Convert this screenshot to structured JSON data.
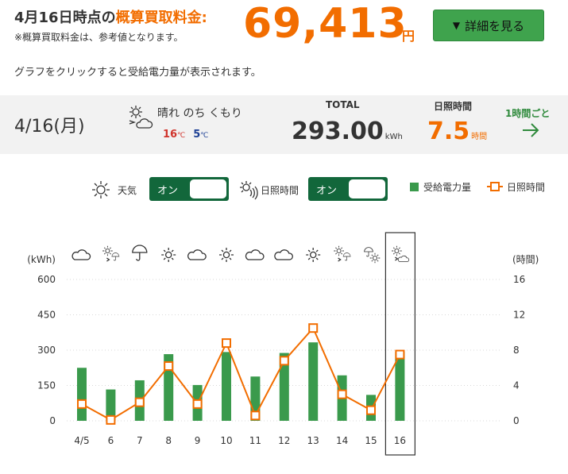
{
  "header": {
    "title_prefix": "4月16日時点の",
    "title_accent": "概算買取料金:",
    "amount": "69,413",
    "unit": "円",
    "note": "※概算買取料金は、参考値となります。",
    "detail_button": "詳細を見る",
    "hint": "グラフをクリックすると受給電力量が表示されます。"
  },
  "summary": {
    "date": "4/16(月)",
    "weather": "晴れ のち くもり",
    "temp_high": "16",
    "temp_low": "5",
    "temp_unit": "℃",
    "total_label": "TOTAL",
    "total_value": "293.00",
    "total_unit": "kWh",
    "sunshine_label": "日照時間",
    "sunshine_value": "7.5",
    "sunshine_unit": "時間",
    "hourly_link": "1時間ごと"
  },
  "controls": {
    "weather_label": "天気",
    "weather_toggle": "オン",
    "sunshine_label": "日照時間",
    "sunshine_toggle": "オン",
    "legend_power": "受給電力量",
    "legend_sunshine": "日照時間"
  },
  "colors": {
    "accent": "#f26d00",
    "button": "#3fa34d",
    "toggle": "#12673b",
    "bar": "#3a9a4c",
    "line": "#f26d00",
    "saturday": "#2a7fb8",
    "sunday": "#c2185b"
  },
  "chart_data": {
    "type": "bar",
    "categories": [
      "4/5",
      "6",
      "7",
      "8",
      "9",
      "10",
      "11",
      "12",
      "13",
      "14",
      "15",
      "16"
    ],
    "category_colors": [
      "#333333",
      "#333333",
      "#2a7fb8",
      "#c2185b",
      "#333333",
      "#333333",
      "#333333",
      "#333333",
      "#333333",
      "#2a7fb8",
      "#c2185b",
      "#333333"
    ],
    "weather_icons": [
      "cloud-icon",
      "sun-to-rain-icon",
      "umbrella-icon",
      "sun-icon",
      "cloud-icon",
      "sun-icon",
      "cloud-icon",
      "cloud-icon",
      "sun-icon",
      "sun-to-rain-icon",
      "rain-and-sun-icon",
      "sun-to-cloud-icon"
    ],
    "selected_index": 11,
    "series": [
      {
        "name": "受給電力量",
        "type": "bar",
        "axis": "left",
        "values": [
          225,
          133,
          172,
          283,
          152,
          292,
          188,
          288,
          333,
          193,
          110,
          293
        ]
      },
      {
        "name": "日照時間",
        "type": "line",
        "axis": "right",
        "values": [
          1.9,
          0.1,
          2.1,
          6.2,
          1.9,
          8.8,
          0.6,
          6.8,
          10.5,
          3.0,
          1.2,
          7.5
        ]
      }
    ],
    "ylabel_left": "(kWh)",
    "ylabel_right": "(時間)",
    "yticks_left": [
      "0",
      "150",
      "300",
      "450",
      "600"
    ],
    "yticks_right": [
      "0",
      "4",
      "8",
      "12",
      "16"
    ],
    "ylim_left": [
      0,
      600
    ],
    "ylim_right": [
      0,
      16
    ],
    "grid": true
  }
}
